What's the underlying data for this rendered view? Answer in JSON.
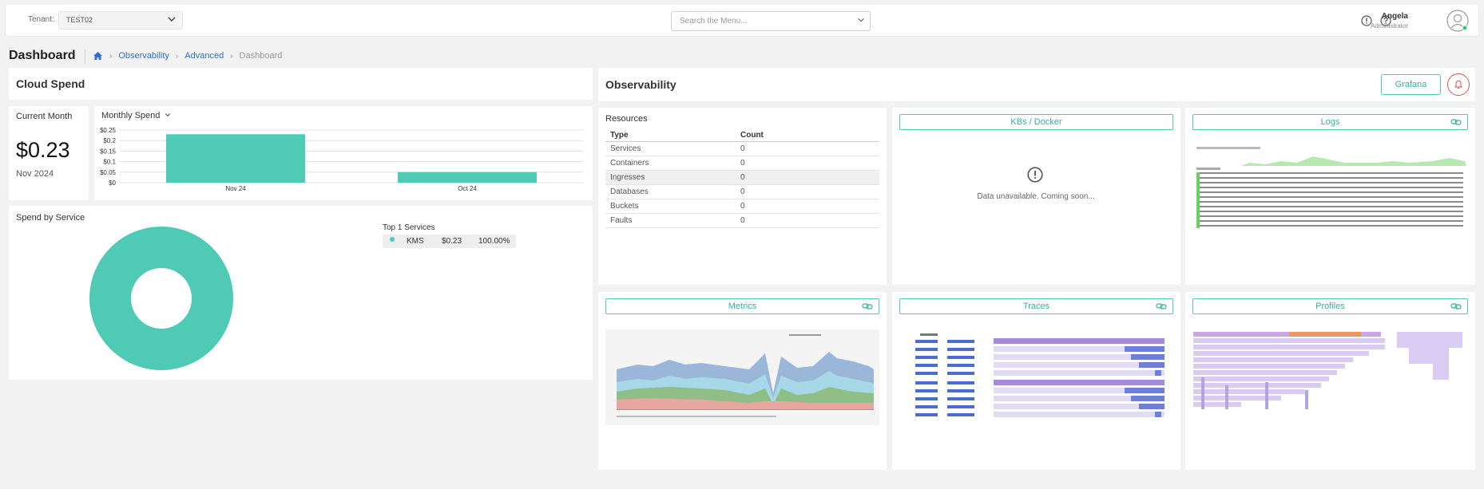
{
  "header": {
    "tenant_label": "Tenant:",
    "tenant_value": "TEST02",
    "search_placeholder": "Search the Menu...",
    "user_name": "Angela",
    "user_role": "Administrator"
  },
  "page": {
    "title": "Dashboard",
    "breadcrumb": [
      "Observability",
      "Advanced",
      "Dashboard"
    ]
  },
  "cloud_spend": {
    "title": "Cloud Spend",
    "current_month_label": "Current Month",
    "current_month_value": "$0.23",
    "current_month_date": "Nov 2024",
    "monthly_spend_label": "Monthly Spend",
    "spend_by_service_label": "Spend by Service",
    "top_services_label": "Top 1 Services",
    "top_services": [
      {
        "name": "KMS",
        "amount": "$0.23",
        "percent": "100.00%"
      }
    ]
  },
  "chart_data": [
    {
      "type": "bar",
      "title": "",
      "categories": [
        "Nov 24",
        "Oct 24"
      ],
      "values": [
        0.23,
        0.05
      ],
      "ylim": [
        0,
        0.25
      ],
      "yticks": [
        "$0",
        "$0.05",
        "$0.1",
        "$0.15",
        "$0.2",
        "$0.25"
      ],
      "grid": true,
      "color": "#4ecab5"
    },
    {
      "type": "pie",
      "title": "",
      "categories": [
        "KMS"
      ],
      "values": [
        100
      ],
      "donut": true,
      "color": "#4ecab5"
    }
  ],
  "observability": {
    "title": "Observability",
    "grafana_label": "Grafana",
    "resources_title": "Resources",
    "resources_headers": [
      "Type",
      "Count"
    ],
    "resources_rows": [
      [
        "Services",
        "0"
      ],
      [
        "Containers",
        "0"
      ],
      [
        "Ingresses",
        "0"
      ],
      [
        "Databases",
        "0"
      ],
      [
        "Buckets",
        "0"
      ],
      [
        "Faults",
        "0"
      ]
    ],
    "kbs_label": "KBs / Docker",
    "unavailable_text": "Data unavailable. Coming soon...",
    "logs_label": "Logs",
    "metrics_label": "Metrics",
    "traces_label": "Traces",
    "profiles_label": "Profiles"
  },
  "colors": {
    "accent": "#4ecab5",
    "link": "#2f6fd8",
    "alert": "#d9534f"
  },
  "icons": [
    "chevron-down-icon",
    "info-icon",
    "help-icon",
    "user-avatar-icon",
    "home-icon",
    "bell-icon",
    "external-link-icon",
    "alert-circle-icon"
  ]
}
